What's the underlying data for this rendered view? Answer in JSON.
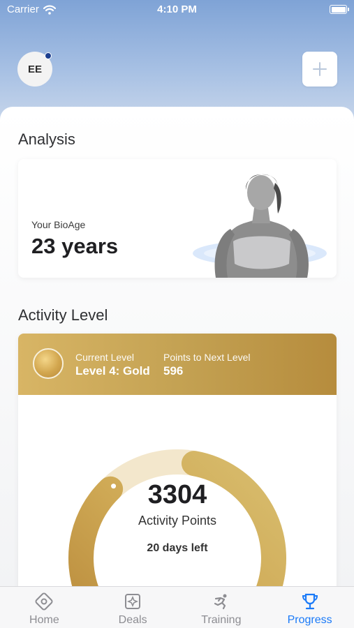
{
  "status_bar": {
    "carrier": "Carrier",
    "time": "4:10 PM"
  },
  "header": {
    "avatar_initials": "EE"
  },
  "analysis": {
    "title": "Analysis",
    "bioage_label": "Your BioAge",
    "bioage_value": "23 years"
  },
  "activity": {
    "title": "Activity Level",
    "current_level_caption": "Current Level",
    "current_level_value": "Level 4: Gold",
    "points_next_caption": "Points to Next Level",
    "points_next_value": "596",
    "points": "3304",
    "points_label": "Activity Points",
    "days_left": "20 days left",
    "progress_fraction": 0.85
  },
  "tabs": [
    {
      "label": "Home",
      "icon": "home-icon"
    },
    {
      "label": "Deals",
      "icon": "deals-icon"
    },
    {
      "label": "Training",
      "icon": "training-icon"
    },
    {
      "label": "Progress",
      "icon": "trophy-icon",
      "active": true
    }
  ],
  "colors": {
    "accent": "#1a7af8",
    "gold": "#c9a352",
    "gold_light": "#f3e7cc"
  }
}
